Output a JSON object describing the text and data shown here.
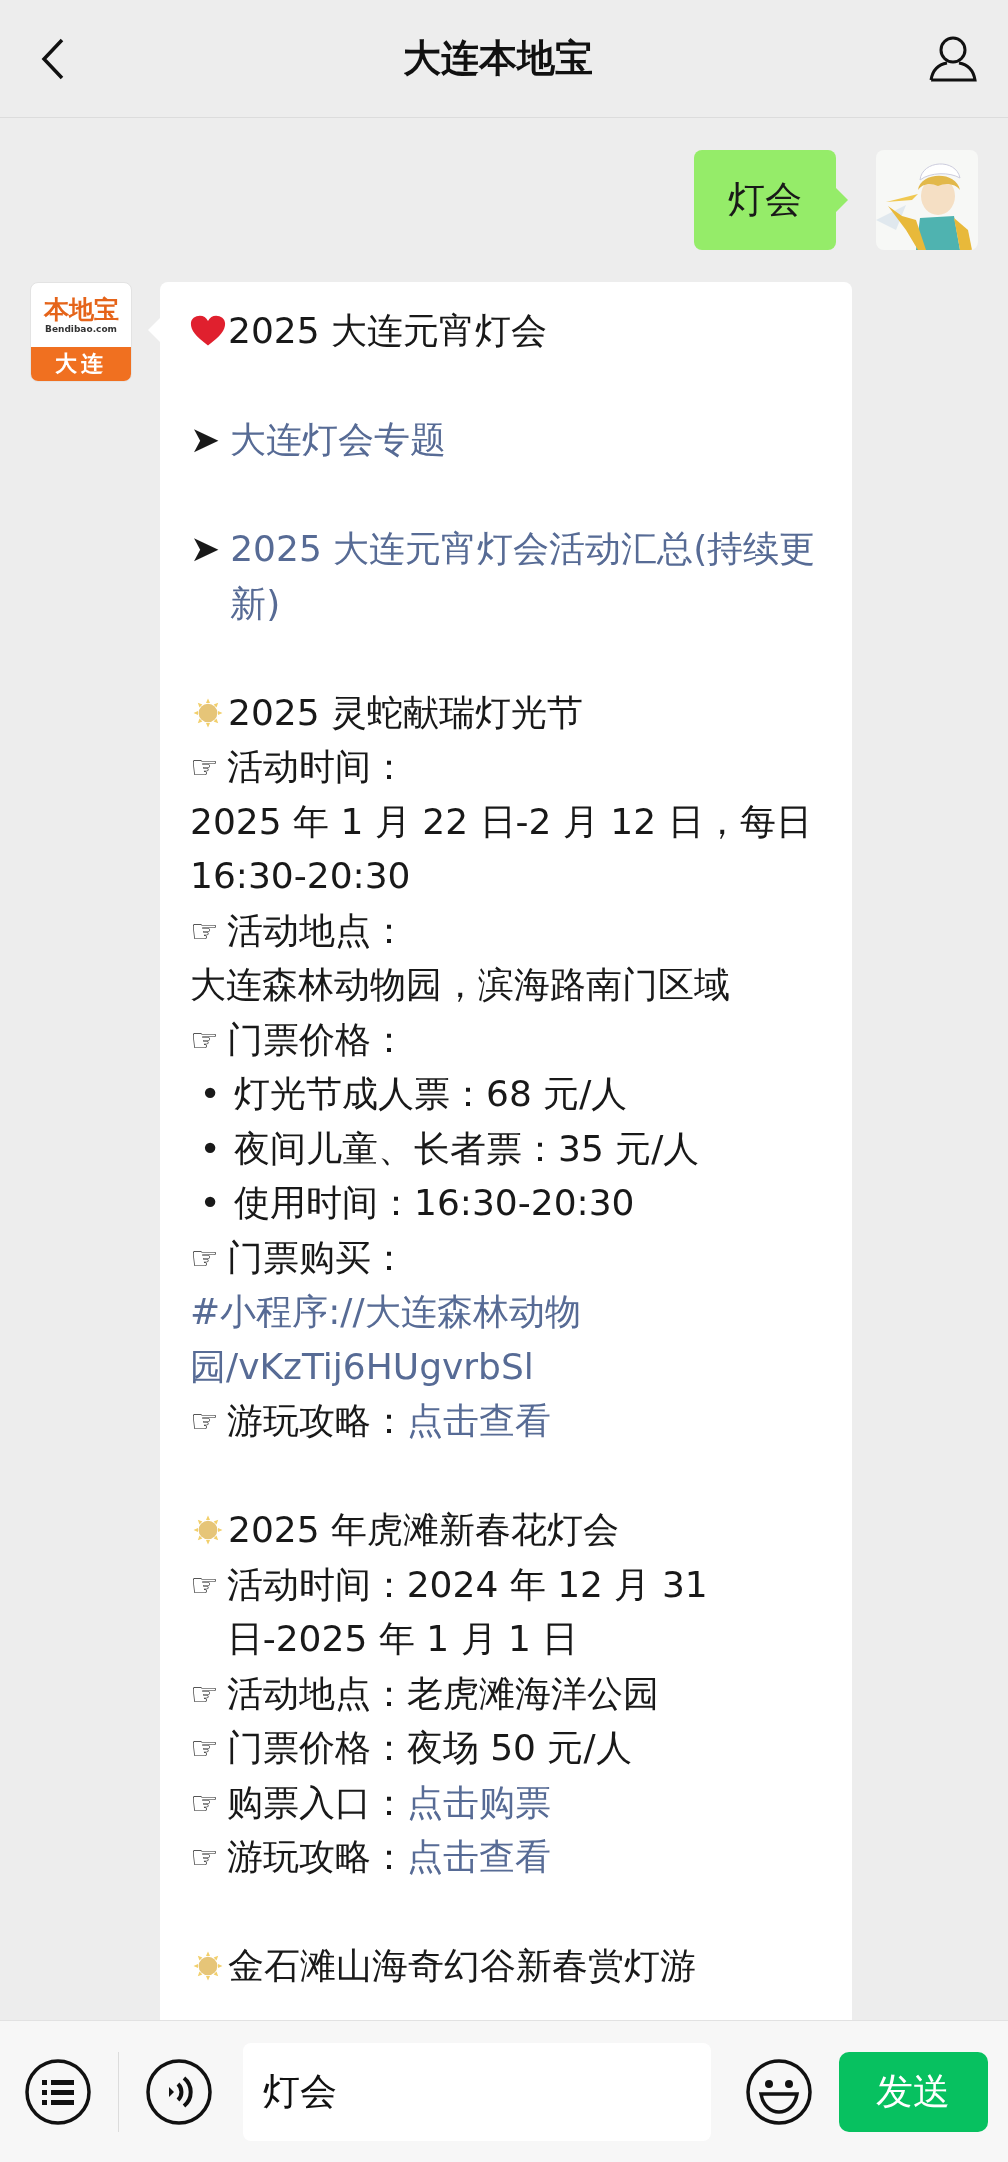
{
  "header": {
    "title": "大连本地宝"
  },
  "sent_message": {
    "text": "灯会"
  },
  "bot_logo": {
    "brand": "本地宝",
    "site": "Bendibao.com",
    "city": "大连"
  },
  "reply": {
    "lines": [
      {
        "kind": "title",
        "text": "2025 大连元宵灯会"
      },
      {
        "kind": "gap"
      },
      {
        "kind": "link",
        "marker": "➤",
        "link": "大连灯会专题"
      },
      {
        "kind": "gap"
      },
      {
        "kind": "link",
        "marker": "➤",
        "link": "2025 大连元宵灯会活动汇总(持续更新)"
      },
      {
        "kind": "gap"
      },
      {
        "kind": "section",
        "text": "2025 灵蛇献瑞灯光节"
      },
      {
        "kind": "pointer",
        "marker": "☞",
        "text": "活动时间："
      },
      {
        "kind": "plain",
        "text": "2025 年 1 月 22 日-2 月 12 日，每日16:30-20:30"
      },
      {
        "kind": "pointer",
        "marker": "☞",
        "text": "活动地点："
      },
      {
        "kind": "plain",
        "text": "大连森林动物园，滨海路南门区域"
      },
      {
        "kind": "pointer",
        "marker": "☞",
        "text": "门票价格："
      },
      {
        "kind": "bullet",
        "marker": "•",
        "text": "灯光节成人票：68 元/人"
      },
      {
        "kind": "bullet",
        "marker": "•",
        "text": "夜间儿童、长者票：35 元/人"
      },
      {
        "kind": "bullet",
        "marker": "•",
        "text": "使用时间：16:30-20:30"
      },
      {
        "kind": "pointer",
        "marker": "☞",
        "text": "门票购买："
      },
      {
        "kind": "link",
        "link": "#小程序://大连森林动物园/vKzTij6HUgvrbSl"
      },
      {
        "kind": "pointer",
        "marker": "☞",
        "text": "游玩攻略：",
        "link": "点击查看"
      },
      {
        "kind": "gap"
      },
      {
        "kind": "section",
        "text": "2025 年虎滩新春花灯会"
      },
      {
        "kind": "pointer",
        "marker": "☞",
        "text": "活动时间：2024 年 12 月 31 日-2025 年 1 月 1 日"
      },
      {
        "kind": "pointer",
        "marker": "☞",
        "text": "活动地点：老虎滩海洋公园"
      },
      {
        "kind": "pointer",
        "marker": "☞",
        "text": "门票价格：夜场 50 元/人"
      },
      {
        "kind": "pointer",
        "marker": "☞",
        "text": "购票入口：",
        "link": "点击购票"
      },
      {
        "kind": "pointer",
        "marker": "☞",
        "text": "游玩攻略：",
        "link": "点击查看"
      },
      {
        "kind": "gap"
      },
      {
        "kind": "section",
        "text": "金石滩山海奇幻谷新春赏灯游"
      }
    ]
  },
  "input_bar": {
    "value": "灯会",
    "send_button": "发送"
  }
}
